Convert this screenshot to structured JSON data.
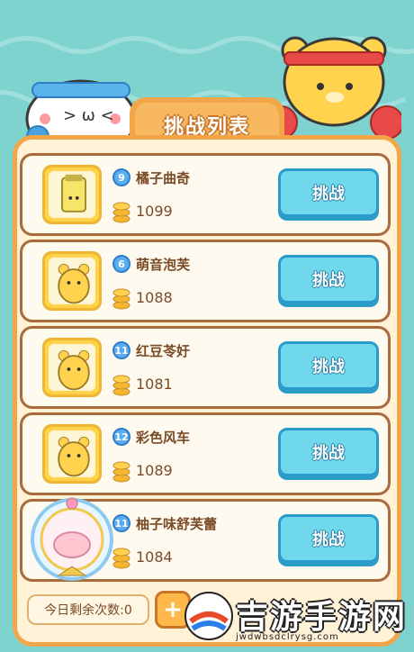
{
  "panel": {
    "title": "挑战列表"
  },
  "rows": [
    {
      "level": "9",
      "name": "橘子曲奇",
      "coins": "1099",
      "button": "挑战"
    },
    {
      "level": "6",
      "name": "萌音泡芙",
      "coins": "1088",
      "button": "挑战"
    },
    {
      "level": "11",
      "name": "红豆苓㚥",
      "coins": "1081",
      "button": "挑战"
    },
    {
      "level": "12",
      "name": "彩色风车",
      "coins": "1089",
      "button": "挑战"
    },
    {
      "level": "11",
      "name": "柚子味舒芙蕾",
      "coins": "1084",
      "button": "挑战"
    }
  ],
  "footer": {
    "remaining": "今日剩余次数:0",
    "add": "+"
  },
  "watermark": {
    "title": "吉游手游网",
    "url": "jwdwbsdclrysg.com"
  },
  "colors": {
    "background": "#7fd3cf",
    "panel_border": "#f2a64a",
    "button": "#6fd8ec"
  }
}
